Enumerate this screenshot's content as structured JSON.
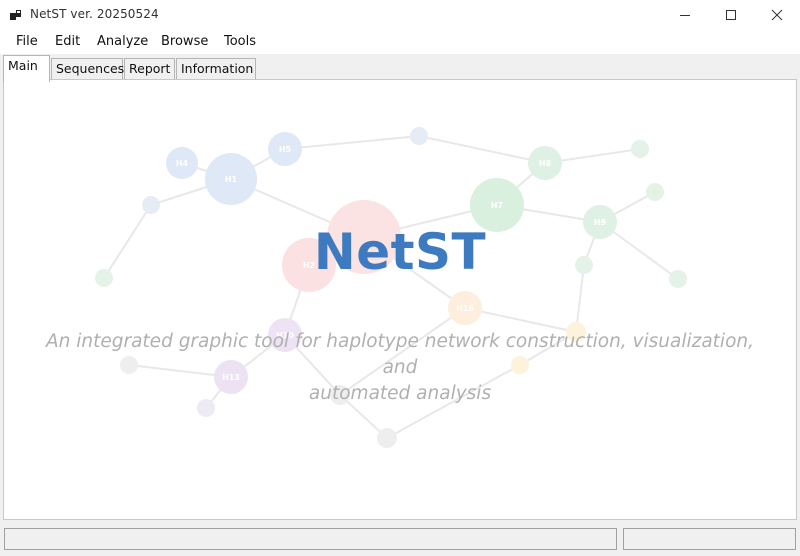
{
  "window": {
    "title": "NetST ver. 20250524",
    "icons": [
      "app-icon",
      "minimize-icon",
      "maximize-icon",
      "close-icon"
    ]
  },
  "menu": {
    "items": [
      "File",
      "Edit",
      "Analyze",
      "Browse",
      "Tools"
    ]
  },
  "tabs": {
    "items": [
      "Main",
      "Sequences",
      "Report",
      "Information"
    ],
    "selected": "Main"
  },
  "main": {
    "title": "NetST",
    "subtitle_line1": "An integrated graphic tool for haplotype network construction, visualization, and",
    "subtitle_line2": "automated analysis",
    "title_color": "#3d7abf",
    "subtitle_color": "#b0b0b0"
  },
  "status": {
    "left_text": "",
    "right_text": ""
  }
}
